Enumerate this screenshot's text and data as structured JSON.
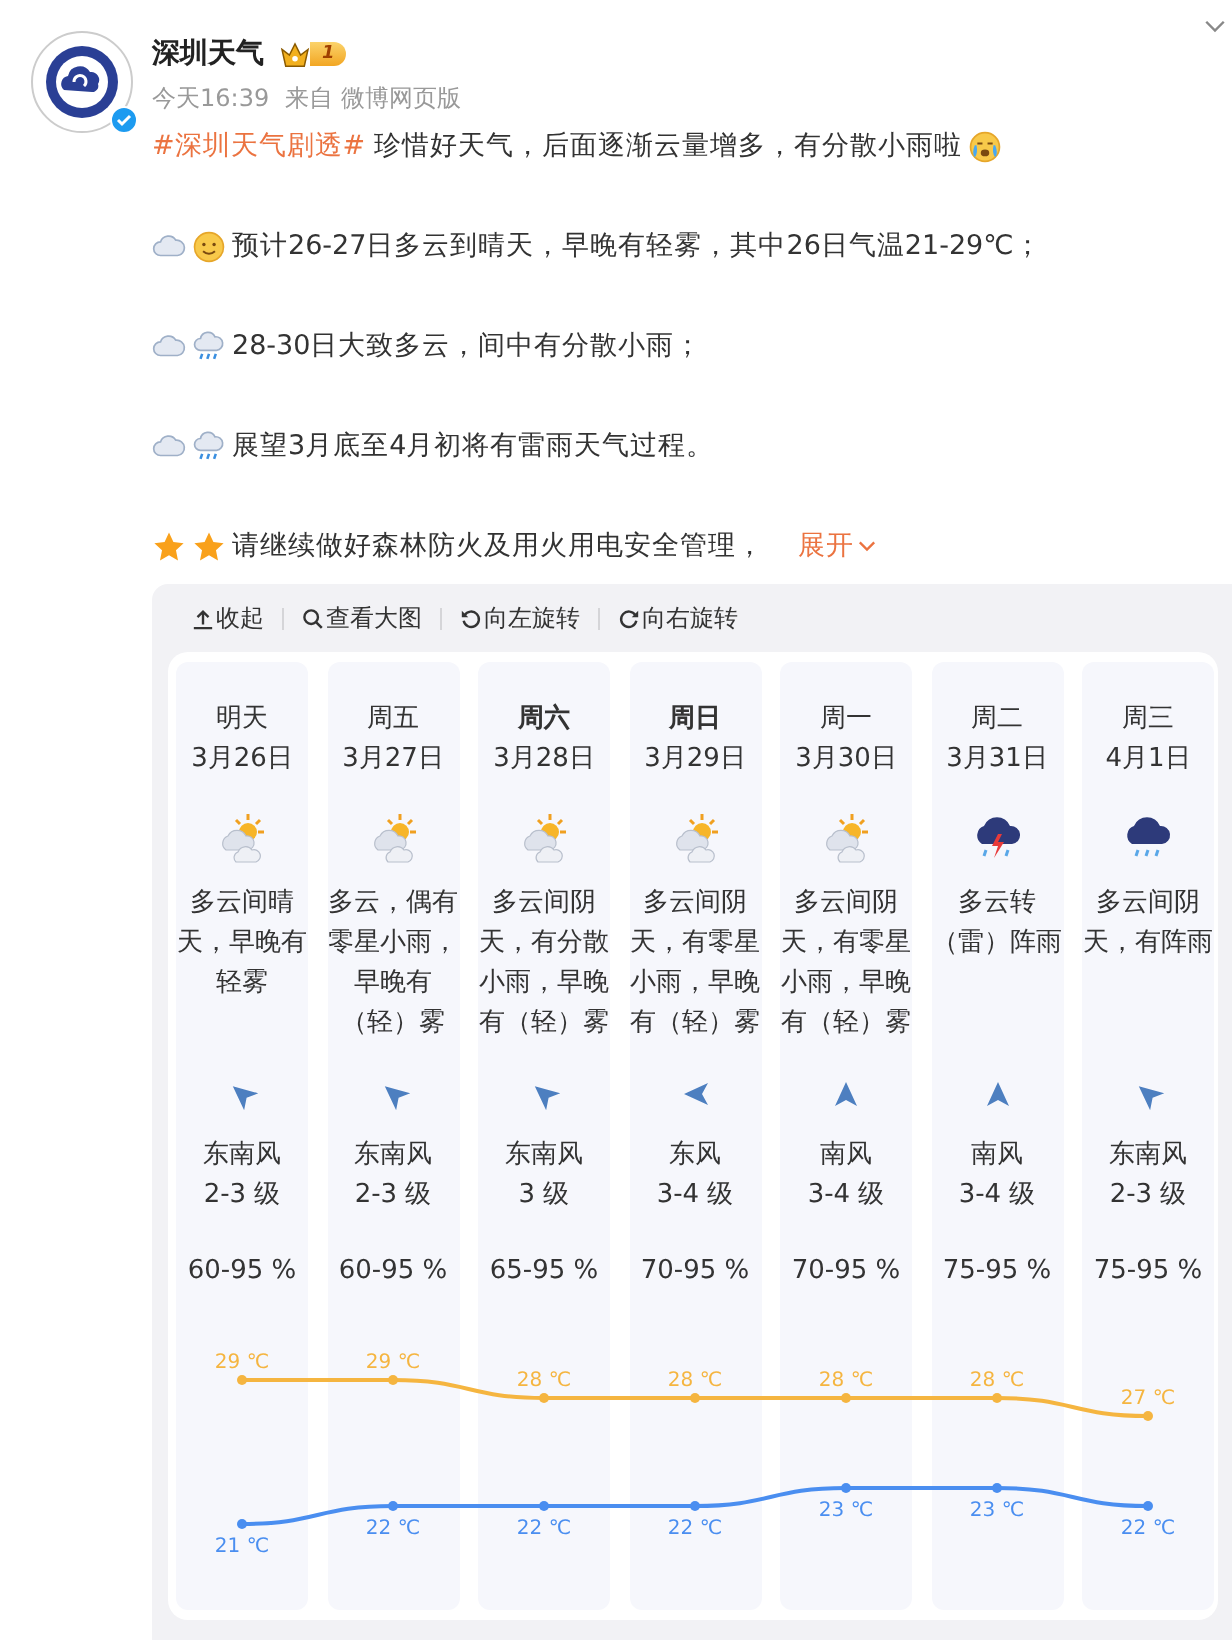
{
  "post": {
    "author": "深圳天气",
    "level_badge": "1",
    "verified": true,
    "time": "今天16:39",
    "source": "来自 微博网页版",
    "headline": {
      "hashtag": "#深圳天气剧透#",
      "text": "珍惜好天气，后面逐渐云量增多，有分散小雨啦"
    },
    "lines": [
      {
        "kind": "sunny",
        "text": "预计26-27日多云到晴天，早晚有轻雾，其中26日气温21-29℃；"
      },
      {
        "kind": "rainy",
        "text": "28-30日大致多云，间中有分散小雨；"
      },
      {
        "kind": "rainy",
        "text": "展望3月底至4月初将有雷雨天气过程。"
      },
      {
        "kind": "stars",
        "text": "请继续做好森林防火及用火用电安全管理，"
      }
    ],
    "expand": "展开"
  },
  "image_toolbar": [
    {
      "kind": "collapse",
      "label": "收起"
    },
    {
      "kind": "zoom",
      "label": "查看大图"
    },
    {
      "kind": "rotate_left",
      "label": "向左旋转"
    },
    {
      "kind": "rotate_right",
      "label": "向右旋转"
    }
  ],
  "forecast": {
    "days": [
      {
        "day": "明天",
        "weekend": false,
        "date": "3月26日",
        "kind": "cloudy_sun",
        "description": "多云间晴天，早晚有轻雾",
        "wind": {
          "kind": "southeast",
          "text": "东南风"
        },
        "wind_level": "2-3 级",
        "humidity": "60-95 %"
      },
      {
        "day": "周五",
        "weekend": false,
        "date": "3月27日",
        "kind": "cloudy_sun",
        "description": "多云，偶有零星小雨，早晚有（轻）雾",
        "wind": {
          "kind": "southeast",
          "text": "东南风"
        },
        "wind_level": "2-3 级",
        "humidity": "60-95 %"
      },
      {
        "day": "周六",
        "weekend": true,
        "date": "3月28日",
        "kind": "cloudy_sun",
        "description": "多云间阴天，有分散小雨，早晚有（轻）雾",
        "wind": {
          "kind": "southeast",
          "text": "东南风"
        },
        "wind_level": "3 级",
        "humidity": "65-95 %"
      },
      {
        "day": "周日",
        "weekend": true,
        "date": "3月29日",
        "kind": "cloudy_sun",
        "description": "多云间阴天，有零星小雨，早晚有（轻）雾",
        "wind": {
          "kind": "east",
          "text": "东风"
        },
        "wind_level": "3-4 级",
        "humidity": "70-95 %"
      },
      {
        "day": "周一",
        "weekend": false,
        "date": "3月30日",
        "kind": "cloudy_sun",
        "description": "多云间阴天，有零星小雨，早晚有（轻）雾",
        "wind": {
          "kind": "south",
          "text": "南风"
        },
        "wind_level": "3-4 级",
        "humidity": "70-95 %"
      },
      {
        "day": "周二",
        "weekend": false,
        "date": "3月31日",
        "kind": "thunder_rain",
        "description": "多云转（雷）阵雨",
        "wind": {
          "kind": "south",
          "text": "南风"
        },
        "wind_level": "3-4 级",
        "humidity": "75-95 %"
      },
      {
        "day": "周三",
        "weekend": false,
        "date": "4月1日",
        "kind": "rain",
        "description": "多云间阴天，有阵雨",
        "wind": {
          "kind": "southeast",
          "text": "东南风"
        },
        "wind_level": "2-3 级",
        "humidity": "75-95 %"
      }
    ],
    "chart_data": {
      "type": "line",
      "data_labels": true,
      "series": [
        {
          "color": "#f5b540",
          "marker": "circle",
          "values": [
            29,
            29,
            28,
            28,
            28,
            28,
            27
          ],
          "value_labels": [
            "29 ℃",
            "29 ℃",
            "28 ℃",
            "28 ℃",
            "28 ℃",
            "28 ℃",
            "27 ℃"
          ]
        },
        {
          "color": "#4a8ef0",
          "marker": "circle",
          "values": [
            21,
            22,
            22,
            22,
            23,
            23,
            22
          ],
          "value_labels": [
            "21 ℃",
            "22 ℃",
            "22 ℃",
            "22 ℃",
            "23 ℃",
            "23 ℃",
            "22 ℃"
          ]
        }
      ]
    }
  }
}
